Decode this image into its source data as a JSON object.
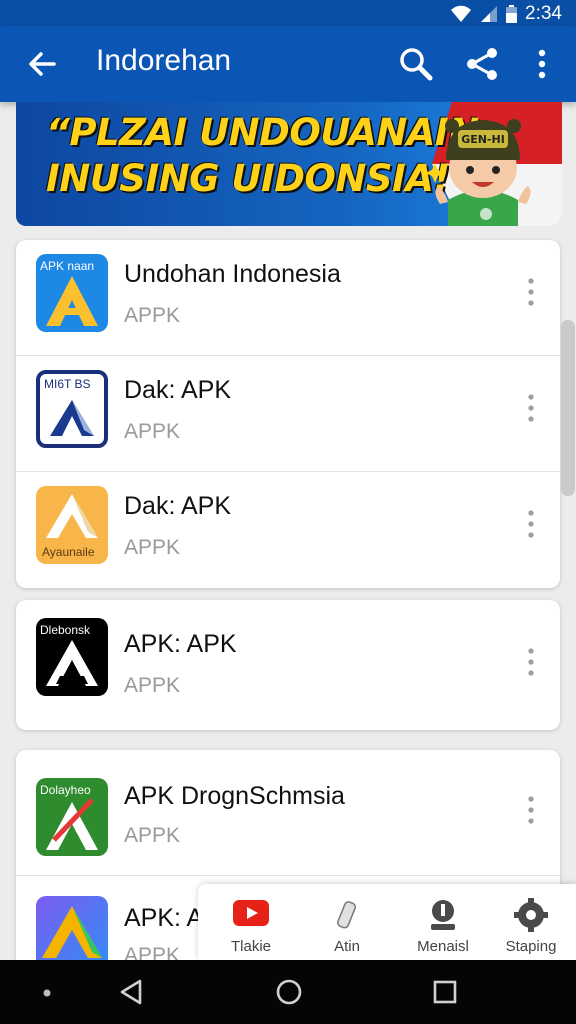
{
  "status_bar": {
    "time": "2:34"
  },
  "app_bar": {
    "title": "Indorehan",
    "back_icon": "arrow-left-icon",
    "search_icon": "search-icon",
    "share_icon": "share-icon",
    "more_icon": "more-vert-icon"
  },
  "banner": {
    "text": "“PLZAI UNDOUANAIN\nINUSING UIDONSIA!",
    "mascot_cap_text": "GEN-HI"
  },
  "cards": [
    {
      "rows": [
        {
          "name": "Undohan Indonesia",
          "sub": "APPK",
          "icon_text": "APK naan",
          "icon_colors": [
            "#1e88e5",
            "#fbc02d"
          ]
        },
        {
          "name": "Dak: APK",
          "sub": "APPK",
          "icon_text": "MI6T BS",
          "icon_colors": [
            "#ffffff",
            "#1a3a8f"
          ]
        },
        {
          "name": "Dak: APK",
          "sub": "APPK",
          "icon_text": "Ayaunaile",
          "icon_colors": [
            "#f7b54a",
            "#ffffff"
          ]
        }
      ]
    },
    {
      "rows": [
        {
          "name": "APK: APK",
          "sub": "APPK",
          "icon_text": "Dlebonsk",
          "icon_colors": [
            "#000000",
            "#ffffff"
          ]
        }
      ]
    },
    {
      "rows": [
        {
          "name": "APK DrognSchmsia",
          "sub": "APPK",
          "icon_text": "Dolayheo",
          "icon_colors": [
            "#2e8b2e",
            "#ffffff"
          ]
        },
        {
          "name": "APK: A",
          "sub": "APPK",
          "icon_text": "",
          "icon_colors": [
            "#3b6fe0",
            "#f5b400"
          ]
        }
      ]
    }
  ],
  "bottom_nav": [
    {
      "label": "Tlakie",
      "icon": "youtube-icon"
    },
    {
      "label": "Atin",
      "icon": "pencil-icon"
    },
    {
      "label": "Menaisl",
      "icon": "person-icon"
    },
    {
      "label": "Staping",
      "icon": "gear-icon"
    }
  ],
  "system_nav": {
    "back": "triangle-back-icon",
    "home": "circle-home-icon",
    "recents": "square-recents-icon"
  },
  "colors": {
    "app_bar": "#0b56b4",
    "banner_text": "#ffd21a"
  }
}
